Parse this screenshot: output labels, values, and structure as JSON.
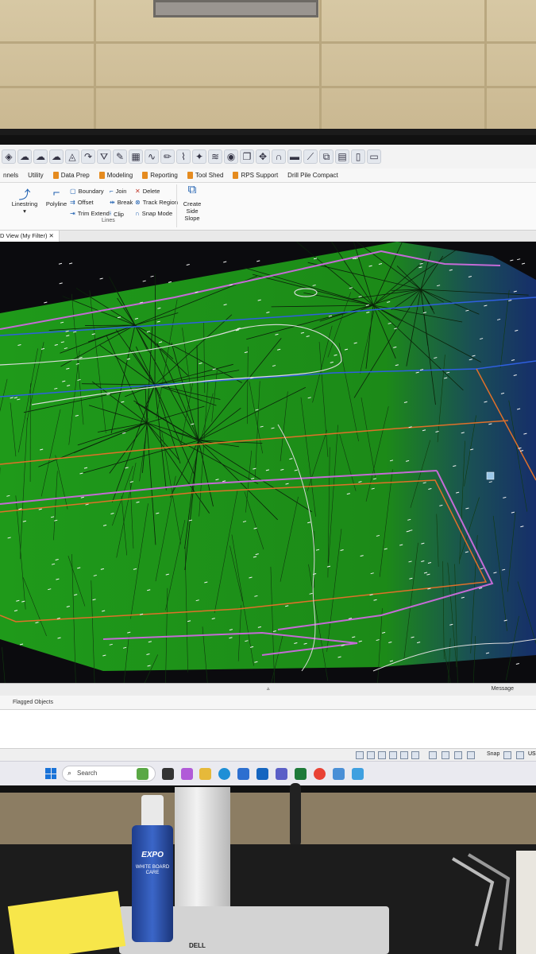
{
  "ribbon": {
    "tabs": [
      {
        "label": "nnels",
        "flag": false
      },
      {
        "label": "Utility",
        "flag": false
      },
      {
        "label": "Data Prep",
        "flag": true
      },
      {
        "label": "Modeling",
        "flag": true
      },
      {
        "label": "Reporting",
        "flag": true
      },
      {
        "label": "Tool Shed",
        "flag": true
      },
      {
        "label": "RPS Support",
        "flag": true
      },
      {
        "label": "Drill Pile Compact",
        "flag": false
      }
    ],
    "buttons": {
      "linestring": "Linestring",
      "polyline": "Polyline",
      "boundary": "Boundary",
      "offset": "Offset",
      "trim_extend": "Trim Extend",
      "join": "Join",
      "break": "Break",
      "clip": "Clip",
      "delete": "Delete",
      "track_region": "Track Region",
      "snap_mode": "Snap Mode",
      "create_side_slope_line1": "Create",
      "create_side_slope_line2": "Side Slope"
    },
    "panel_caption": "Lines"
  },
  "viewport": {
    "tab_label": "D View (My Filter)",
    "surface_color": "#1f9a1a",
    "triangle_edge_color": "#0d2a0b",
    "break_line_color": "#c46bd6",
    "boundary_color": "#e0702a",
    "road_line_color": "#2f5fe0"
  },
  "bottom_panels": {
    "message_label": "Message",
    "flagged_label": "Flagged Objects",
    "snap_label": "Snap",
    "right_edge_text": "US"
  },
  "taskbar": {
    "search_placeholder": "Search"
  },
  "desk": {
    "marker_brand": "EXPO",
    "marker_sub": "WHITE BOARD CARE",
    "stand_brand": "DELL"
  }
}
